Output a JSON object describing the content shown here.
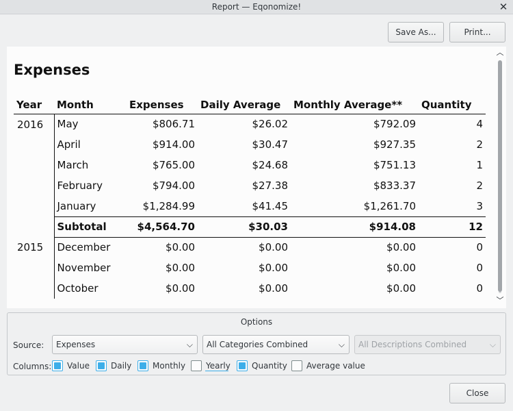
{
  "window": {
    "title": "Report — Eqonomize!"
  },
  "toolbar": {
    "save_as": "Save As...",
    "print": "Print..."
  },
  "report": {
    "heading": "Expenses",
    "columns": [
      "Year",
      "Month",
      "Expenses",
      "Daily Average",
      "Monthly Average**",
      "Quantity"
    ],
    "rows": [
      {
        "year": "2016",
        "month": "May",
        "expenses": "$806.71",
        "daily": "$26.02",
        "monthly": "$792.09",
        "qty": "4"
      },
      {
        "year": "",
        "month": "April",
        "expenses": "$914.00",
        "daily": "$30.47",
        "monthly": "$927.35",
        "qty": "2"
      },
      {
        "year": "",
        "month": "March",
        "expenses": "$765.00",
        "daily": "$24.68",
        "monthly": "$751.13",
        "qty": "1"
      },
      {
        "year": "",
        "month": "February",
        "expenses": "$794.00",
        "daily": "$27.38",
        "monthly": "$833.37",
        "qty": "2"
      },
      {
        "year": "",
        "month": "January",
        "expenses": "$1,284.99",
        "daily": "$41.45",
        "monthly": "$1,261.70",
        "qty": "3"
      },
      {
        "year": "",
        "month": "Subtotal",
        "expenses": "$4,564.70",
        "daily": "$30.03",
        "monthly": "$914.08",
        "qty": "12"
      },
      {
        "year": "2015",
        "month": "December",
        "expenses": "$0.00",
        "daily": "$0.00",
        "monthly": "$0.00",
        "qty": "0"
      },
      {
        "year": "",
        "month": "November",
        "expenses": "$0.00",
        "daily": "$0.00",
        "monthly": "$0.00",
        "qty": "0"
      },
      {
        "year": "",
        "month": "October",
        "expenses": "$0.00",
        "daily": "$0.00",
        "monthly": "$0.00",
        "qty": "0"
      }
    ]
  },
  "options": {
    "title": "Options",
    "source_label": "Source:",
    "source_value": "Expenses",
    "category_value": "All Categories Combined",
    "description_value": "All Descriptions Combined",
    "columns_label": "Columns:",
    "checkboxes": [
      {
        "label": "Value",
        "checked": true
      },
      {
        "label": "Daily",
        "checked": true
      },
      {
        "label": "Monthly",
        "checked": true
      },
      {
        "label": "Yearly",
        "checked": false
      },
      {
        "label": "Quantity",
        "checked": true
      },
      {
        "label": "Average value",
        "checked": false
      }
    ]
  },
  "footer": {
    "close": "Close"
  },
  "colors": {
    "accent": "#3daee9",
    "window_bg": "#eff0f1",
    "report_bg": "#fcfcfc"
  },
  "icons": {
    "close": "close-icon",
    "combo": "chevron-down-icon",
    "scroll_up": "chevron-up-icon",
    "scroll_down": "chevron-down-icon"
  }
}
